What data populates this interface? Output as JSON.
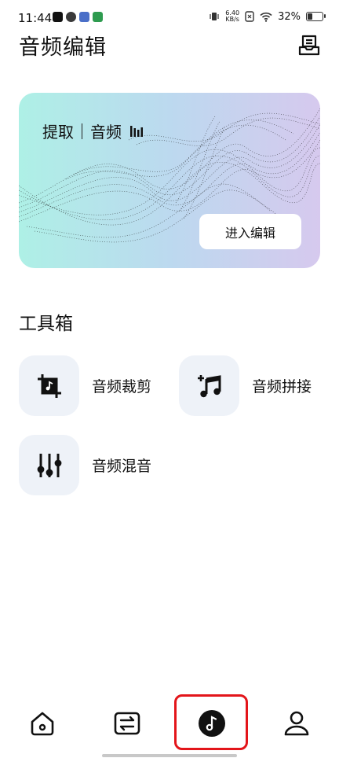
{
  "status_bar": {
    "time": "11:44",
    "net_speed_value": "6.40",
    "net_speed_unit": "KB/s",
    "battery": "32%",
    "battery_level": 0.32
  },
  "header": {
    "title": "音频编辑",
    "inbox_icon": "inbox-icon"
  },
  "hero": {
    "extract_label": "提取",
    "audio_label": "音频",
    "enter_button": "进入编辑",
    "gradient_colors": [
      "#aef0e6",
      "#bcd9ef",
      "#d6c9ee"
    ]
  },
  "toolbox": {
    "title": "工具箱",
    "items": [
      {
        "label": "音频裁剪",
        "icon": "crop-music-icon"
      },
      {
        "label": "音频拼接",
        "icon": "music-plus-icon"
      },
      {
        "label": "音频混音",
        "icon": "mixer-sliders-icon"
      }
    ]
  },
  "bottom_nav": {
    "items": [
      {
        "icon": "home-icon",
        "selected": false
      },
      {
        "icon": "convert-icon",
        "selected": false
      },
      {
        "icon": "music-note-icon",
        "selected": true
      },
      {
        "icon": "profile-icon",
        "selected": false
      }
    ],
    "highlight_color": "#e3151a"
  }
}
